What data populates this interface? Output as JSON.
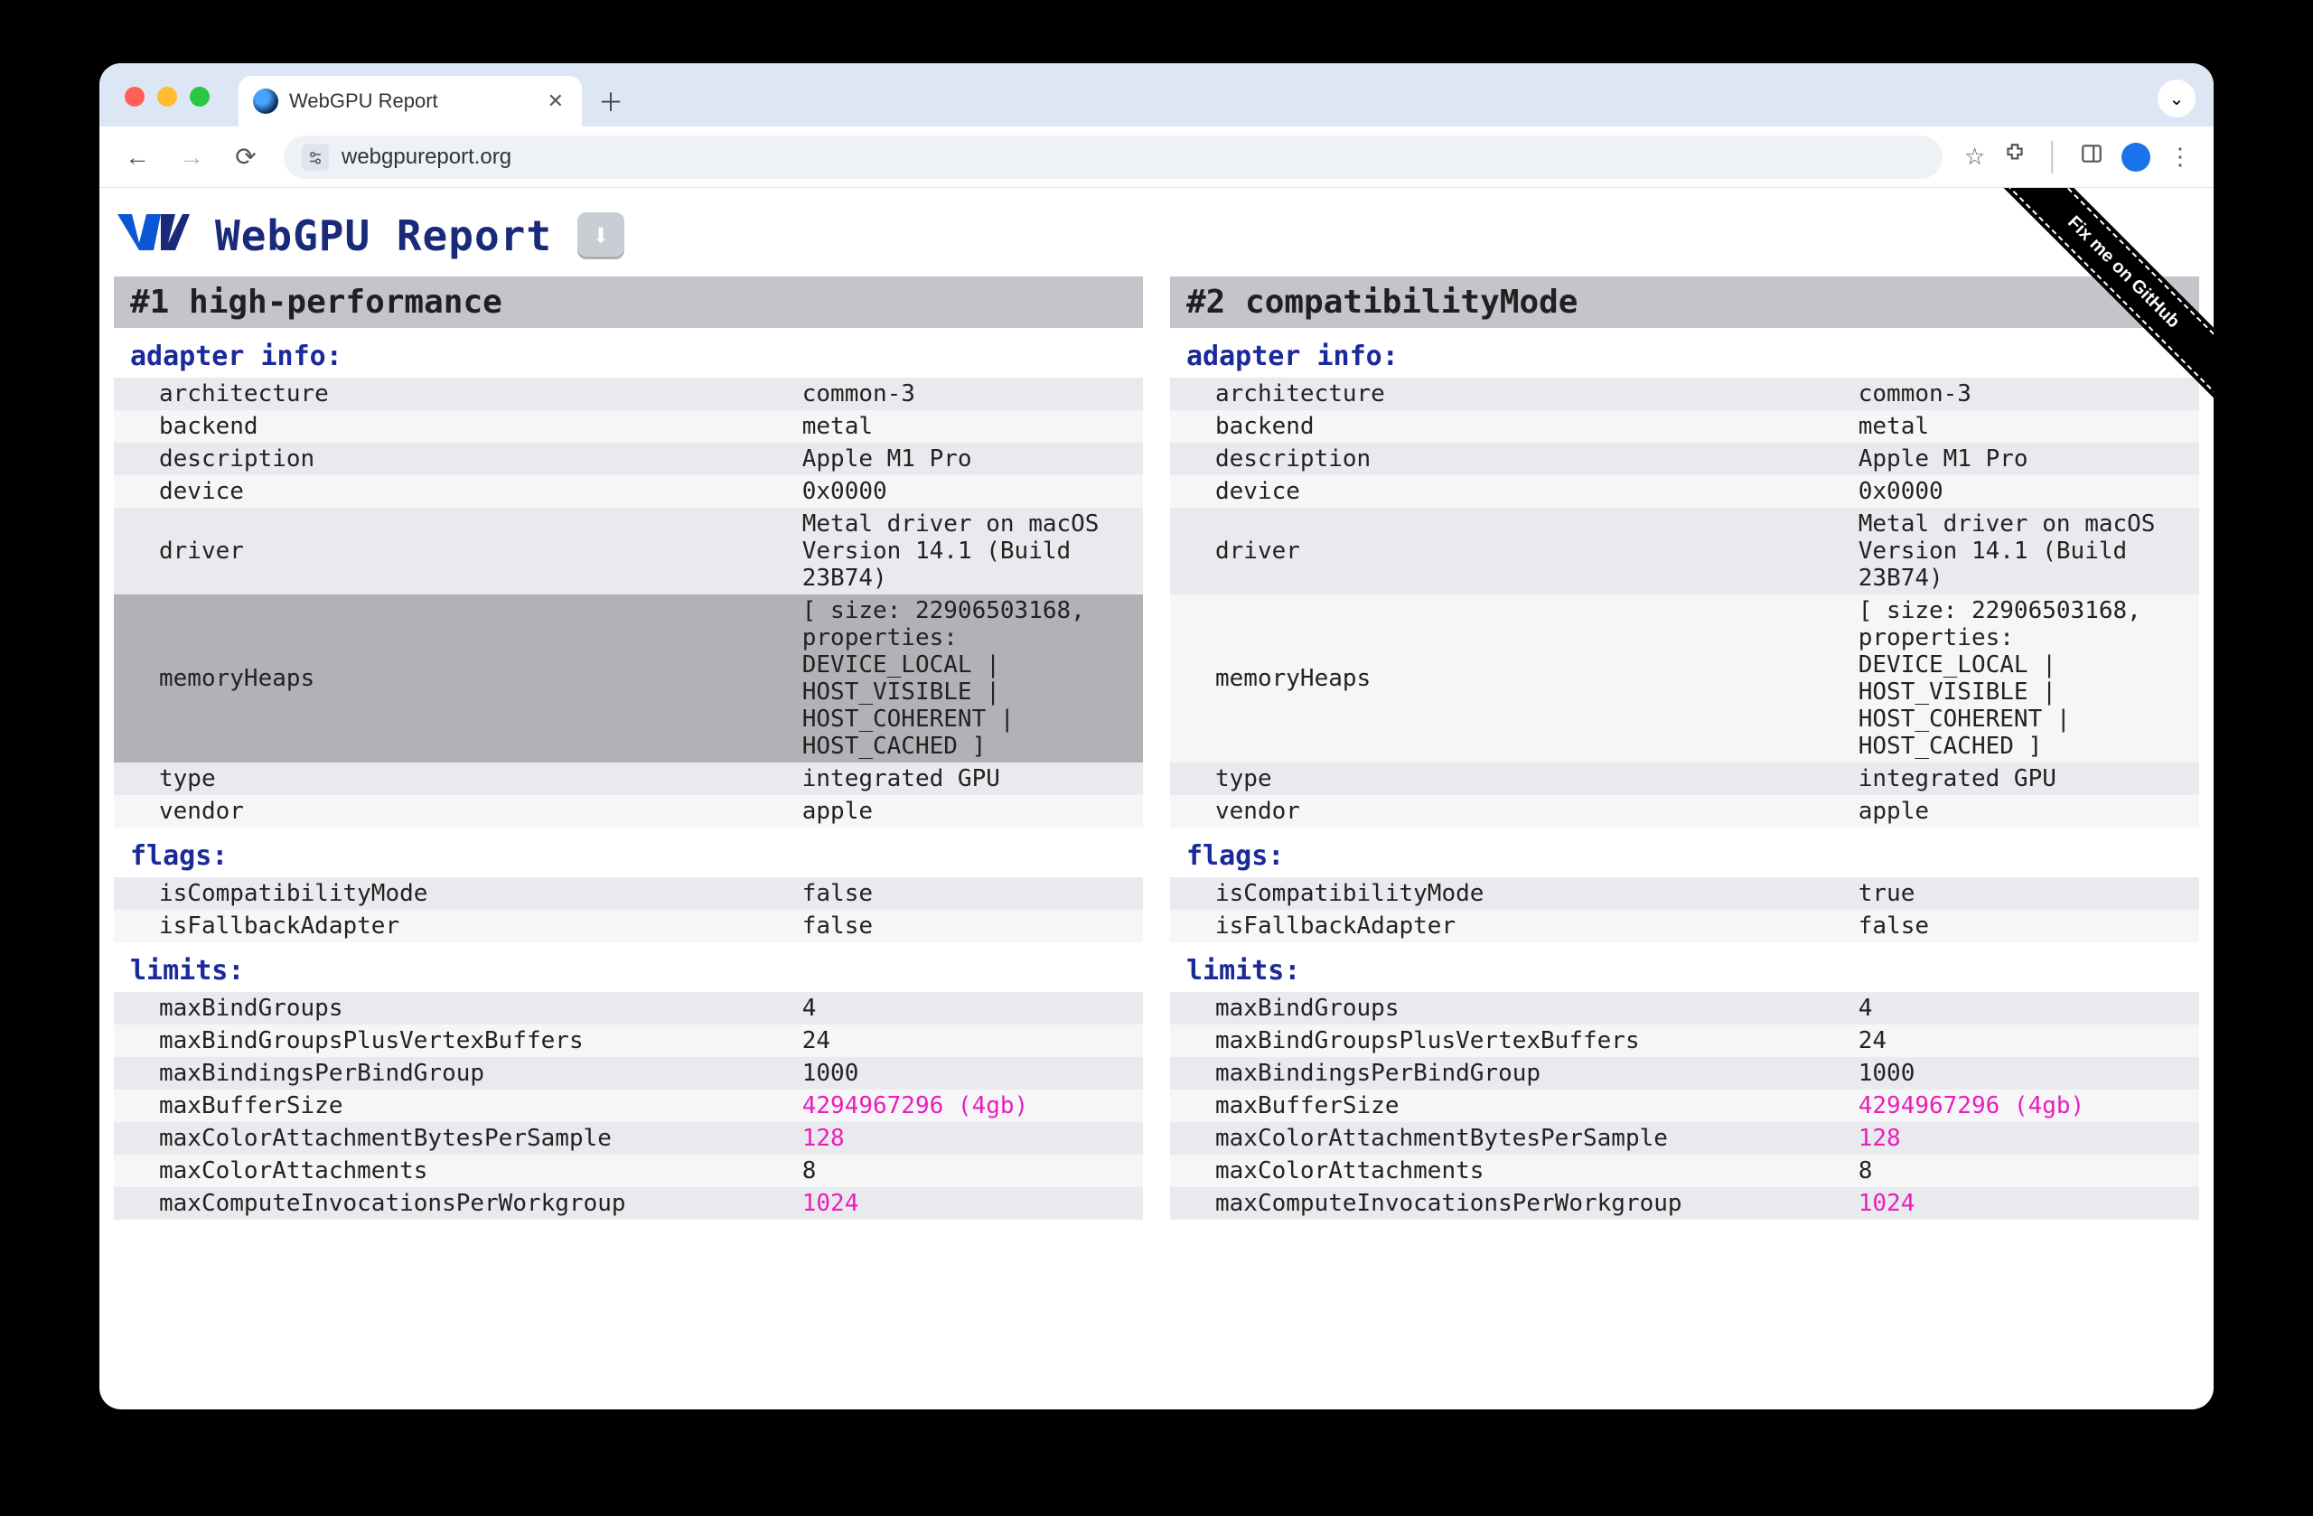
{
  "browser": {
    "tab_title": "WebGPU Report",
    "url": "webgpureport.org"
  },
  "page": {
    "title": "WebGPU Report",
    "download_icon": "⬇",
    "github_ribbon": "Fix me on GitHub"
  },
  "adapters": [
    {
      "heading": "#1 high-performance",
      "sections": {
        "adapter_info": {
          "title": "adapter info:",
          "rows": [
            {
              "k": "architecture",
              "v": "common-3"
            },
            {
              "k": "backend",
              "v": "metal"
            },
            {
              "k": "description",
              "v": "Apple M1 Pro"
            },
            {
              "k": "device",
              "v": "0x0000"
            },
            {
              "k": "driver",
              "v": "Metal driver on macOS Version 14.1 (Build 23B74)"
            },
            {
              "k": "memoryHeaps",
              "v": "[ size: 22906503168, properties: DEVICE_LOCAL | HOST_VISIBLE | HOST_COHERENT | HOST_CACHED ]",
              "hl": true
            },
            {
              "k": "type",
              "v": "integrated GPU"
            },
            {
              "k": "vendor",
              "v": "apple"
            }
          ]
        },
        "flags": {
          "title": "flags:",
          "rows": [
            {
              "k": "isCompatibilityMode",
              "v": "false"
            },
            {
              "k": "isFallbackAdapter",
              "v": "false"
            }
          ]
        },
        "limits": {
          "title": "limits:",
          "rows": [
            {
              "k": "maxBindGroups",
              "v": "4"
            },
            {
              "k": "maxBindGroupsPlusVertexBuffers",
              "v": "24"
            },
            {
              "k": "maxBindingsPerBindGroup",
              "v": "1000"
            },
            {
              "k": "maxBufferSize",
              "v": "4294967296 (4gb)",
              "pink": true
            },
            {
              "k": "maxColorAttachmentBytesPerSample",
              "v": "128",
              "pink": true
            },
            {
              "k": "maxColorAttachments",
              "v": "8"
            },
            {
              "k": "maxComputeInvocationsPerWorkgroup",
              "v": "1024",
              "pink": true
            }
          ]
        }
      }
    },
    {
      "heading": "#2 compatibilityMode",
      "sections": {
        "adapter_info": {
          "title": "adapter info:",
          "rows": [
            {
              "k": "architecture",
              "v": "common-3"
            },
            {
              "k": "backend",
              "v": "metal"
            },
            {
              "k": "description",
              "v": "Apple M1 Pro"
            },
            {
              "k": "device",
              "v": "0x0000"
            },
            {
              "k": "driver",
              "v": "Metal driver on macOS Version 14.1 (Build 23B74)"
            },
            {
              "k": "memoryHeaps",
              "v": "[ size: 22906503168, properties: DEVICE_LOCAL | HOST_VISIBLE | HOST_COHERENT | HOST_CACHED ]"
            },
            {
              "k": "type",
              "v": "integrated GPU"
            },
            {
              "k": "vendor",
              "v": "apple"
            }
          ]
        },
        "flags": {
          "title": "flags:",
          "rows": [
            {
              "k": "isCompatibilityMode",
              "v": "true"
            },
            {
              "k": "isFallbackAdapter",
              "v": "false"
            }
          ]
        },
        "limits": {
          "title": "limits:",
          "rows": [
            {
              "k": "maxBindGroups",
              "v": "4"
            },
            {
              "k": "maxBindGroupsPlusVertexBuffers",
              "v": "24"
            },
            {
              "k": "maxBindingsPerBindGroup",
              "v": "1000"
            },
            {
              "k": "maxBufferSize",
              "v": "4294967296 (4gb)",
              "pink": true
            },
            {
              "k": "maxColorAttachmentBytesPerSample",
              "v": "128",
              "pink": true
            },
            {
              "k": "maxColorAttachments",
              "v": "8"
            },
            {
              "k": "maxComputeInvocationsPerWorkgroup",
              "v": "1024",
              "pink": true
            }
          ]
        }
      }
    }
  ]
}
